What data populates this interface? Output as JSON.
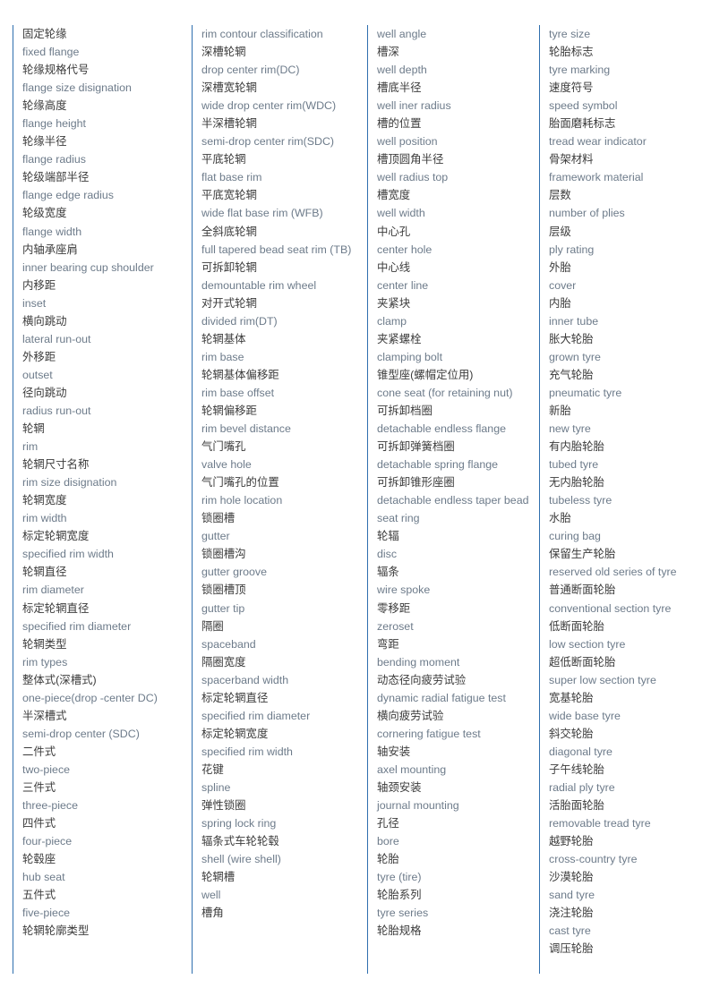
{
  "document": {
    "title": "Wheel and Tyre Bilingual Glossary",
    "accent_color": "#2f6fae",
    "chinese_text_color": "#3b3b3b",
    "english_text_color": "#6d7b8a",
    "background_color": "#ffffff",
    "column_count": 4
  },
  "columns": [
    {
      "name": "column-1",
      "entries": [
        {
          "zh": "固定轮缘",
          "en": "fixed flange"
        },
        {
          "zh": "轮缘规格代号",
          "en": "flange size disignation"
        },
        {
          "zh": "轮缘高度",
          "en": "flange height"
        },
        {
          "zh": "轮缘半径",
          "en": "flange radius"
        },
        {
          "zh": "轮级端部半径",
          "en": "flange edge radius"
        },
        {
          "zh": "轮级宽度",
          "en": "flange width"
        },
        {
          "zh": "内轴承座肩",
          "en": "inner bearing cup shoulder"
        },
        {
          "zh": "内移距",
          "en": "inset"
        },
        {
          "zh": "横向跳动",
          "en": "lateral run-out"
        },
        {
          "zh": "外移距",
          "en": "outset"
        },
        {
          "zh": "径向跳动",
          "en": "radius run-out"
        },
        {
          "zh": "轮辋",
          "en": "rim"
        },
        {
          "zh": "轮辋尺寸名称",
          "en": "rim size disignation"
        },
        {
          "zh": "轮辋宽度",
          "en": "rim width"
        },
        {
          "zh": "标定轮辋宽度",
          "en": "specified rim width"
        },
        {
          "zh": "轮辋直径",
          "en": "rim diameter"
        },
        {
          "zh": "标定轮辋直径",
          "en": "specified rim diameter"
        },
        {
          "zh": "轮辋类型",
          "en": "rim types"
        },
        {
          "zh": "整体式(深槽式)",
          "en": "one-piece(drop -center DC)"
        },
        {
          "zh": "半深槽式",
          "en": "semi-drop center (SDC)"
        },
        {
          "zh": "二件式",
          "en": "two-piece"
        },
        {
          "zh": "三件式",
          "en": "three-piece"
        },
        {
          "zh": "四件式",
          "en": "four-piece"
        },
        {
          "zh": "轮毂座",
          "en": "hub seat"
        },
        {
          "zh": "五件式",
          "en": "five-piece"
        },
        {
          "zh": "轮辋轮廓类型",
          "en": ""
        }
      ]
    },
    {
      "name": "column-2",
      "entries": [
        {
          "zh": "",
          "en": "rim contour classification"
        },
        {
          "zh": "深槽轮辋",
          "en": "drop center rim(DC)"
        },
        {
          "zh": "深槽宽轮辋",
          "en": "wide drop center rim(WDC)"
        },
        {
          "zh": "半深槽轮辋",
          "en": "semi-drop center rim(SDC)"
        },
        {
          "zh": "平底轮辋",
          "en": "flat base rim"
        },
        {
          "zh": "平底宽轮辋",
          "en": "wide flat base rim (WFB)"
        },
        {
          "zh": "全斜底轮辋",
          "en": "full tapered bead seat rim (TB)"
        },
        {
          "zh": "可拆卸轮辋",
          "en": "demountable rim wheel"
        },
        {
          "zh": "对开式轮辋",
          "en": "divided rim(DT)"
        },
        {
          "zh": "轮辋基体",
          "en": "rim base"
        },
        {
          "zh": "轮辋基体偏移距",
          "en": "rim base offset"
        },
        {
          "zh": "轮辋偏移距",
          "en": "rim bevel distance"
        },
        {
          "zh": "气门嘴孔",
          "en": "valve hole"
        },
        {
          "zh": "气门嘴孔的位置",
          "en": "rim hole location"
        },
        {
          "zh": "锁圈槽",
          "en": "gutter"
        },
        {
          "zh": "锁圈槽沟",
          "en": "gutter groove"
        },
        {
          "zh": "锁圈槽顶",
          "en": "gutter tip"
        },
        {
          "zh": "隔圈",
          "en": "spaceband"
        },
        {
          "zh": "隔圈宽度",
          "en": "spacerband width"
        },
        {
          "zh": "标定轮辋直径",
          "en": "specified rim diameter"
        },
        {
          "zh": "标定轮辋宽度",
          "en": "specified rim width"
        },
        {
          "zh": "花键",
          "en": "spline"
        },
        {
          "zh": "弹性锁圈",
          "en": "spring lock ring"
        },
        {
          "zh": "辐条式车轮轮毂",
          "en": "shell (wire shell)"
        },
        {
          "zh": "轮辋槽",
          "en": "well"
        },
        {
          "zh": "槽角",
          "en": ""
        }
      ]
    },
    {
      "name": "column-3",
      "entries": [
        {
          "zh": "",
          "en": "well angle"
        },
        {
          "zh": "槽深",
          "en": "well depth"
        },
        {
          "zh": "槽底半径",
          "en": "well iner radius"
        },
        {
          "zh": "槽的位置",
          "en": "well position"
        },
        {
          "zh": "槽顶圆角半径",
          "en": "well radius top"
        },
        {
          "zh": "槽宽度",
          "en": "well width"
        },
        {
          "zh": "中心孔",
          "en": "center hole"
        },
        {
          "zh": "中心线",
          "en": "center line"
        },
        {
          "zh": "夹紧块",
          "en": "clamp"
        },
        {
          "zh": "夹紧螺栓",
          "en": "clamping bolt"
        },
        {
          "zh": "锥型座(螺帽定位用)",
          "en": "cone seat (for retaining nut)"
        },
        {
          "zh": "可拆卸档圈",
          "en": "detachable endless flange"
        },
        {
          "zh": "可拆卸弹簧档圈",
          "en": "detachable spring flange"
        },
        {
          "zh": "可拆卸锥形座圈",
          "en": "detachable endless taper bead seat ring"
        },
        {
          "zh": "轮辐",
          "en": "disc"
        },
        {
          "zh": "辐条",
          "en": "wire spoke"
        },
        {
          "zh": "零移距",
          "en": "zeroset"
        },
        {
          "zh": "弯距",
          "en": "bending moment"
        },
        {
          "zh": "动态径向疲劳试验",
          "en": "dynamic radial fatigue test"
        },
        {
          "zh": "横向疲劳试验",
          "en": "cornering fatigue test"
        },
        {
          "zh": "轴安装",
          "en": "axel mounting"
        },
        {
          "zh": "轴颈安装",
          "en": "journal mounting"
        },
        {
          "zh": "孔径",
          "en": "bore"
        },
        {
          "zh": "轮胎",
          "en": "tyre (tire)"
        },
        {
          "zh": "轮胎系列",
          "en": "tyre series"
        },
        {
          "zh": "轮胎规格",
          "en": ""
        }
      ]
    },
    {
      "name": "column-4",
      "entries": [
        {
          "zh": "",
          "en": "tyre size"
        },
        {
          "zh": "轮胎标志",
          "en": "tyre marking"
        },
        {
          "zh": "速度符号",
          "en": "speed symbol"
        },
        {
          "zh": "胎面磨耗标志",
          "en": "tread wear indicator"
        },
        {
          "zh": "骨架材料",
          "en": "framework material"
        },
        {
          "zh": "层数",
          "en": "number of plies"
        },
        {
          "zh": "层级",
          "en": "ply rating"
        },
        {
          "zh": "外胎",
          "en": "cover"
        },
        {
          "zh": "内胎",
          "en": "inner tube"
        },
        {
          "zh": "胀大轮胎",
          "en": "grown tyre"
        },
        {
          "zh": "充气轮胎",
          "en": "pneumatic tyre"
        },
        {
          "zh": "新胎",
          "en": "new tyre"
        },
        {
          "zh": "有内胎轮胎",
          "en": "tubed tyre"
        },
        {
          "zh": "无内胎轮胎",
          "en": "tubeless tyre"
        },
        {
          "zh": "水胎",
          "en": "curing bag"
        },
        {
          "zh": "保留生产轮胎",
          "en": "reserved old series of tyre"
        },
        {
          "zh": "普通断面轮胎",
          "en": "conventional section tyre"
        },
        {
          "zh": "低断面轮胎",
          "en": "low section tyre"
        },
        {
          "zh": "超低断面轮胎",
          "en": "super low section tyre"
        },
        {
          "zh": "宽基轮胎",
          "en": "wide base tyre"
        },
        {
          "zh": "斜交轮胎",
          "en": "diagonal tyre"
        },
        {
          "zh": "子午线轮胎",
          "en": "radial ply tyre"
        },
        {
          "zh": "活胎面轮胎",
          "en": "removable tread tyre"
        },
        {
          "zh": "越野轮胎",
          "en": "cross-country tyre"
        },
        {
          "zh": "沙漠轮胎",
          "en": "sand tyre"
        },
        {
          "zh": "浇注轮胎",
          "en": "cast tyre"
        },
        {
          "zh": "调压轮胎",
          "en": ""
        }
      ]
    }
  ]
}
